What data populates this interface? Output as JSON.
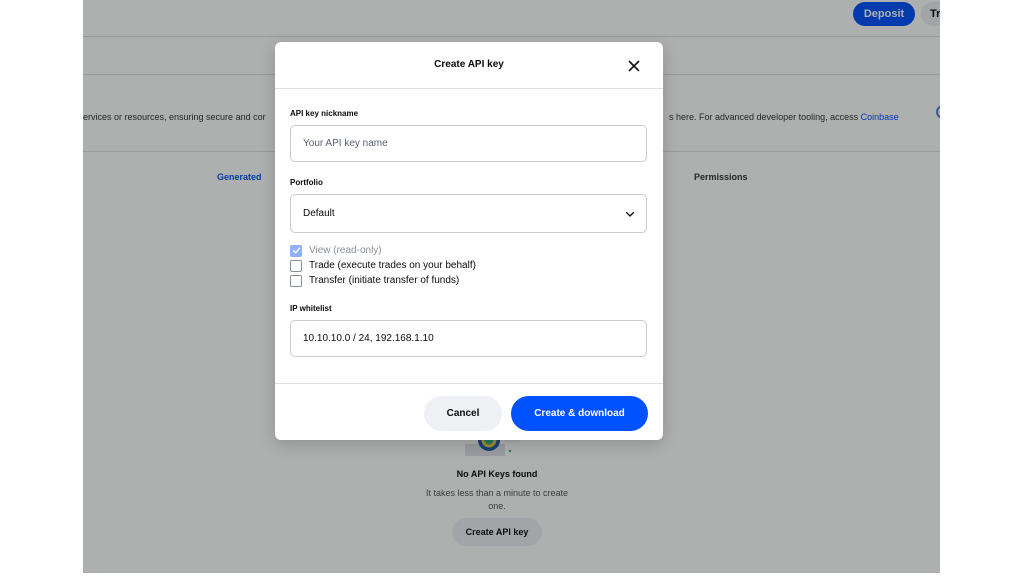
{
  "header": {
    "deposit_label": "Deposit",
    "trade_label": "Tr"
  },
  "description": {
    "left_text": "ervices or resources, ensuring secure and cor",
    "right_text": "s here. For advanced developer tooling, access ",
    "link_text": "Coinbase"
  },
  "tabs": {
    "generated": "Generated",
    "permissions": "Permissions"
  },
  "empty_state": {
    "title": "No API Keys found",
    "subtitle": "It takes less than a minute to create one.",
    "button": "Create API key"
  },
  "modal": {
    "title": "Create API key",
    "nickname": {
      "label": "API key nickname",
      "placeholder": "Your API key name",
      "value": ""
    },
    "portfolio": {
      "label": "Portfolio",
      "selected": "Default"
    },
    "permissions": [
      {
        "label": "View (read-only)",
        "checked": true
      },
      {
        "label": "Trade (execute trades on your behalf)",
        "checked": false
      },
      {
        "label": "Transfer (initiate transfer of funds)",
        "checked": false
      }
    ],
    "ip_whitelist": {
      "label": "IP whitelist",
      "value": "10.10.10.0 / 24, 192.168.1.10"
    },
    "cancel_label": "Cancel",
    "create_label": "Create & download"
  },
  "colors": {
    "accent": "#0052ff",
    "overlay": "#0a0b0d"
  },
  "icons": {
    "close": "close-icon",
    "chevron": "chevron-down-icon",
    "check": "check-icon"
  }
}
